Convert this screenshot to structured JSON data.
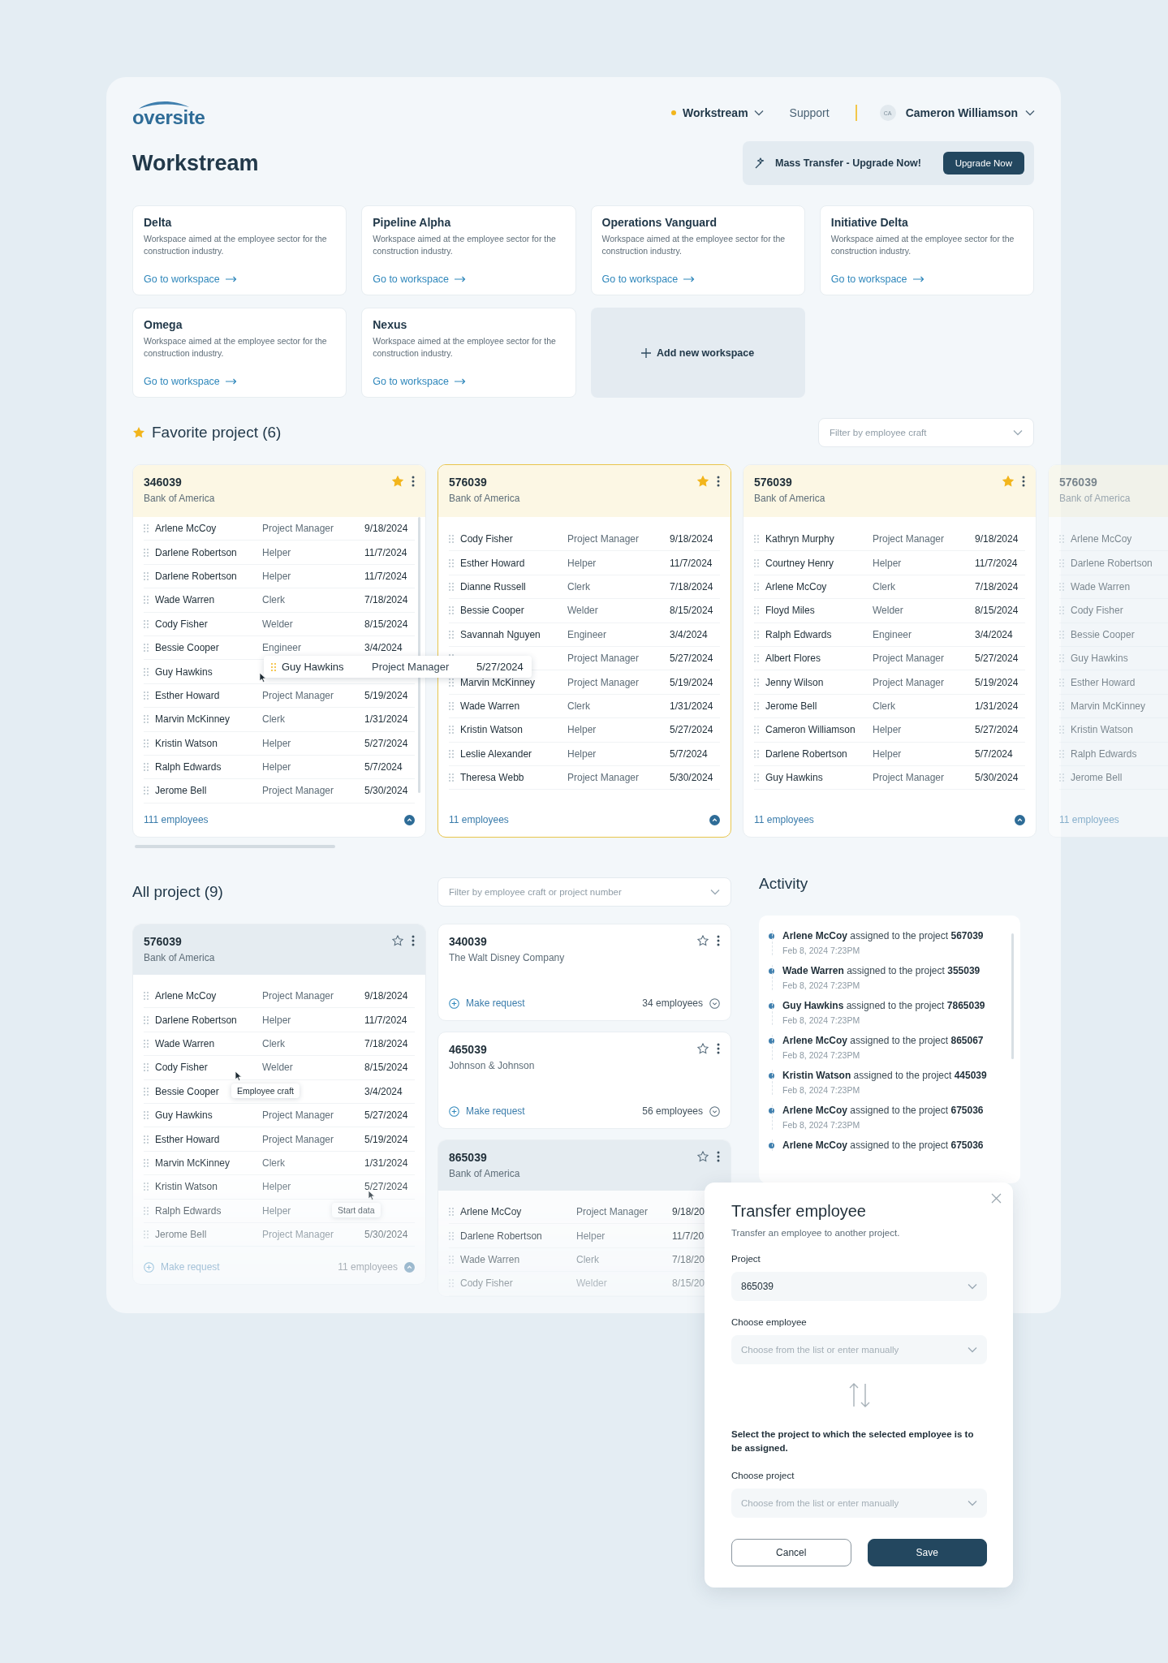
{
  "header": {
    "logo": "oversite",
    "nav": [
      {
        "label": "Workstream",
        "selected": true,
        "kind": "menu"
      },
      {
        "label": "Support",
        "selected": false,
        "kind": "link"
      }
    ],
    "user": {
      "initials": "CA",
      "name": "Cameron Williamson"
    }
  },
  "title": "Workstream",
  "upgrade_banner": {
    "text": "Mass Transfer - Upgrade Now!",
    "button": "Upgrade Now"
  },
  "workspaces": [
    {
      "name": "Delta",
      "description": "Workspace aimed at the employee sector for the construction industry.",
      "link": "Go to workspace"
    },
    {
      "name": "Pipeline Alpha",
      "description": "Workspace aimed at the employee sector for the construction industry.",
      "link": "Go to workspace"
    },
    {
      "name": "Operations Vanguard",
      "description": "Workspace aimed at the employee sector for the construction industry.",
      "link": "Go to workspace"
    },
    {
      "name": "Initiative Delta",
      "description": "Workspace aimed at the employee sector for the construction industry.",
      "link": "Go to workspace"
    },
    {
      "name": "Omega",
      "description": "Workspace aimed at the employee sector for the construction industry.",
      "link": "Go to workspace"
    },
    {
      "name": "Nexus",
      "description": "Workspace aimed at the employee sector for the construction industry.",
      "link": "Go to workspace"
    }
  ],
  "add_workspace": "Add new workspace",
  "favorites": {
    "title": "Favorite project (6)",
    "filter_placeholder": "Filter by employee craft",
    "projects": [
      {
        "number": "346039",
        "company": "Bank of America",
        "favorite": true,
        "selected": false,
        "count": "111 employees",
        "rows": [
          {
            "name": "Arlene McCoy",
            "role": "Project Manager",
            "date": "9/18/2024"
          },
          {
            "name": "Darlene Robertson",
            "role": "Helper",
            "date": "11/7/2024"
          },
          {
            "name": "Darlene Robertson",
            "role": "Helper",
            "date": "11/7/2024"
          },
          {
            "name": "Wade Warren",
            "role": "Clerk",
            "date": "7/18/2024"
          },
          {
            "name": "Cody Fisher",
            "role": "Welder",
            "date": "8/15/2024"
          },
          {
            "name": "Bessie Cooper",
            "role": "Engineer",
            "date": "3/4/2024"
          },
          {
            "name": "Guy Hawkins"
          },
          {
            "name": "Esther Howard",
            "role": "Project Manager",
            "date": "5/19/2024"
          },
          {
            "name": "Marvin McKinney",
            "role": "Clerk",
            "date": "1/31/2024"
          },
          {
            "name": "Kristin Watson",
            "role": "Helper",
            "date": "5/27/2024"
          },
          {
            "name": "Ralph Edwards",
            "role": "Helper",
            "date": "5/7/2024"
          },
          {
            "name": "Jerome Bell",
            "role": "Project Manager",
            "date": "5/30/2024"
          }
        ]
      },
      {
        "number": "576039",
        "company": "Bank of America",
        "favorite": true,
        "selected": true,
        "count": "11 employees",
        "rows": [
          {
            "name": "Cody Fisher",
            "role": "Project Manager",
            "date": "9/18/2024"
          },
          {
            "name": "Esther Howard",
            "role": "Helper",
            "date": "11/7/2024"
          },
          {
            "name": "Dianne Russell",
            "role": "Clerk",
            "date": "7/18/2024"
          },
          {
            "name": "Bessie Cooper",
            "role": "Welder",
            "date": "8/15/2024"
          },
          {
            "name": "Savannah Nguyen",
            "role": "Engineer",
            "date": "3/4/2024"
          },
          {
            "role": "Project Manager",
            "date": "5/27/2024"
          },
          {
            "name": "Marvin McKinney",
            "role": "Project Manager",
            "date": "5/19/2024"
          },
          {
            "name": "Wade Warren",
            "role": "Clerk",
            "date": "1/31/2024"
          },
          {
            "name": "Kristin Watson",
            "role": "Helper",
            "date": "5/27/2024"
          },
          {
            "name": "Leslie Alexander",
            "role": "Helper",
            "date": "5/7/2024"
          },
          {
            "name": "Theresa Webb",
            "role": "Project Manager",
            "date": "5/30/2024"
          }
        ]
      },
      {
        "number": "576039",
        "company": "Bank of America",
        "favorite": true,
        "selected": false,
        "count": "11 employees",
        "rows": [
          {
            "name": "Kathryn Murphy",
            "role": "Project Manager",
            "date": "9/18/2024"
          },
          {
            "name": "Courtney Henry",
            "role": "Helper",
            "date": "11/7/2024"
          },
          {
            "name": "Arlene McCoy",
            "role": "Clerk",
            "date": "7/18/2024"
          },
          {
            "name": "Floyd Miles",
            "role": "Welder",
            "date": "8/15/2024"
          },
          {
            "name": "Ralph Edwards",
            "role": "Engineer",
            "date": "3/4/2024"
          },
          {
            "name": "Albert Flores",
            "role": "Project Manager",
            "date": "5/27/2024"
          },
          {
            "name": "Jenny Wilson",
            "role": "Project Manager",
            "date": "5/19/2024"
          },
          {
            "name": "Jerome Bell",
            "role": "Clerk",
            "date": "1/31/2024"
          },
          {
            "name": "Cameron Williamson",
            "role": "Helper",
            "date": "5/27/2024"
          },
          {
            "name": "Darlene Robertson",
            "role": "Helper",
            "date": "5/7/2024"
          },
          {
            "name": "Guy Hawkins",
            "role": "Project Manager",
            "date": "5/30/2024"
          }
        ]
      },
      {
        "number": "576039",
        "company": "Bank of America",
        "count": "11 employees",
        "rows": [
          {
            "name": "Arlene McCoy"
          },
          {
            "name": "Darlene Robertson"
          },
          {
            "name": "Wade Warren"
          },
          {
            "name": "Cody Fisher"
          },
          {
            "name": "Bessie Cooper"
          },
          {
            "name": "Guy Hawkins"
          },
          {
            "name": "Esther Howard"
          },
          {
            "name": "Marvin McKinney"
          },
          {
            "name": "Kristin Watson"
          },
          {
            "name": "Ralph Edwards"
          },
          {
            "name": "Jerome Bell"
          }
        ]
      }
    ],
    "drag_item": {
      "name": "Guy Hawkins",
      "role": "Project Manager",
      "date": "5/27/2024"
    }
  },
  "all_projects": {
    "title": "All project (9)",
    "filter_placeholder": "Filter by employee craft or project number",
    "columns": [
      [
        {
          "number": "576039",
          "company": "Bank of America",
          "favorite": false,
          "expanded": true,
          "request": "Make request",
          "count": "11 employees",
          "rows": [
            {
              "name": "Arlene McCoy",
              "role": "Project Manager",
              "date": "9/18/2024"
            },
            {
              "name": "Darlene Robertson",
              "role": "Helper",
              "date": "11/7/2024"
            },
            {
              "name": "Wade Warren",
              "role": "Clerk",
              "date": "7/18/2024"
            },
            {
              "name": "Cody Fisher",
              "role": "Welder",
              "date": "8/15/2024"
            },
            {
              "name": "Bessie Cooper",
              "date": "3/4/2024",
              "role_tip": "Employee craft"
            },
            {
              "name": "Guy Hawkins",
              "role": "Project Manager",
              "date": "5/27/2024"
            },
            {
              "name": "Esther Howard",
              "role": "Project Manager",
              "date": "5/19/2024"
            },
            {
              "name": "Marvin McKinney",
              "role": "Clerk",
              "date": "1/31/2024"
            },
            {
              "name": "Kristin Watson",
              "role": "Helper",
              "date": "5/27/2024"
            },
            {
              "name": "Ralph Edwards",
              "role": "Helper",
              "date_tip": "Start data"
            },
            {
              "name": "Jerome Bell",
              "role": "Project Manager",
              "date": "5/30/2024"
            }
          ]
        }
      ],
      [
        {
          "number": "340039",
          "company": "The Walt Disney Company",
          "favorite": false,
          "expanded": false,
          "request": "Make request",
          "count": "34 employees"
        },
        {
          "number": "465039",
          "company": "Johnson & Johnson",
          "favorite": false,
          "expanded": false,
          "request": "Make request",
          "count": "56 employees"
        },
        {
          "number": "865039",
          "company": "Bank of America",
          "favorite": false,
          "expanded": true,
          "rows": [
            {
              "name": "Arlene McCoy",
              "role": "Project Manager",
              "date": "9/18/20"
            },
            {
              "name": "Darlene Robertson",
              "role": "Helper",
              "date": "11/7/20"
            },
            {
              "name": "Wade Warren",
              "role": "Clerk",
              "date": "7/18/20"
            },
            {
              "name": "Cody Fisher",
              "role": "Welder",
              "date": "8/15/20"
            }
          ]
        }
      ]
    ]
  },
  "activity": {
    "title": "Activity",
    "items": [
      {
        "text": "**Arlene McCoy** assigned to the project **567039**",
        "time": "Feb 8, 2024 7:23PM"
      },
      {
        "text": "**Wade Warren** assigned to the project **355039**",
        "time": "Feb 8, 2024 7:23PM"
      },
      {
        "text": "**Guy Hawkins** assigned to the project **7865039**",
        "time": "Feb 8, 2024 7:23PM"
      },
      {
        "text": "**Arlene McCoy** assigned to the project **865067**",
        "time": "Feb 8, 2024 7:23PM"
      },
      {
        "text": "**Kristin Watson** assigned to the project **445039**",
        "time": "Feb 8, 2024 7:23PM"
      },
      {
        "text": "**Arlene McCoy** assigned to the project **675036**",
        "time": "Feb 8, 2024 7:23PM"
      },
      {
        "text": "**Arlene McCoy** assigned to the project **675036**"
      }
    ]
  },
  "modal": {
    "title": "Transfer employee",
    "subtitle": "Transfer an employee to another project.",
    "source_fields": [
      {
        "label": "Project",
        "value": "865039"
      },
      {
        "label": "Choose employee",
        "placeholder": "Choose from the list or enter manually"
      }
    ],
    "instruction": "Select the project to which the selected employee is to be assigned.",
    "target_fields": [
      {
        "label": "Choose project",
        "placeholder": "Choose from the list or enter manually"
      }
    ],
    "buttons": [
      {
        "label": "Cancel",
        "kind": "secondary"
      },
      {
        "label": "Save",
        "kind": "primary"
      }
    ]
  }
}
